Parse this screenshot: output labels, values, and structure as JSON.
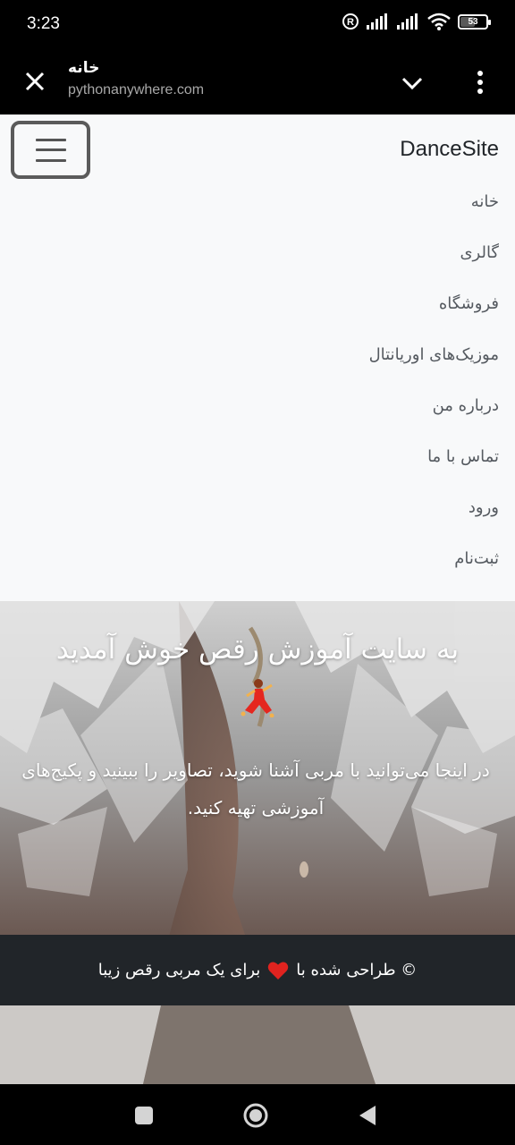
{
  "status_bar": {
    "time": "3:23",
    "battery_level": "53",
    "icons": [
      "registered-icon",
      "signal-icon",
      "signal-icon",
      "wifi-icon",
      "battery-icon"
    ]
  },
  "browser": {
    "tab_title": "خانه",
    "url": "pythonanywhere.com",
    "icons": [
      "close-icon",
      "chevron-down-icon",
      "more-vert-icon"
    ]
  },
  "navbar": {
    "brand": "DanceSite",
    "items": [
      {
        "label": "خانه"
      },
      {
        "label": "گالری"
      },
      {
        "label": "فروشگاه"
      },
      {
        "label": "موزیک‌های اوریانتال"
      },
      {
        "label": "درباره من"
      },
      {
        "label": "تماس با ما"
      },
      {
        "label": "ورود"
      },
      {
        "label": "ثبت‌نام"
      }
    ]
  },
  "hero": {
    "title": "به سایت آموزش رقص خوش آمدید",
    "emoji_icon": "dancer-icon",
    "text": "در اینجا می‌توانید با مربی آشنا شوید، تصاویر را ببینید و پکیج‌های آموزشی تهیه کنید."
  },
  "footer": {
    "text_before": "© طراحی شده با",
    "heart_icon": "heart-icon",
    "text_after": "برای یک مربی رقص زیبا"
  },
  "colors": {
    "navbar_bg": "#f8f9fa",
    "footer_bg": "#212529",
    "brand_text": "#212529",
    "nav_link": "#555a60"
  },
  "system_nav": [
    "recents-icon",
    "home-icon",
    "back-icon"
  ]
}
